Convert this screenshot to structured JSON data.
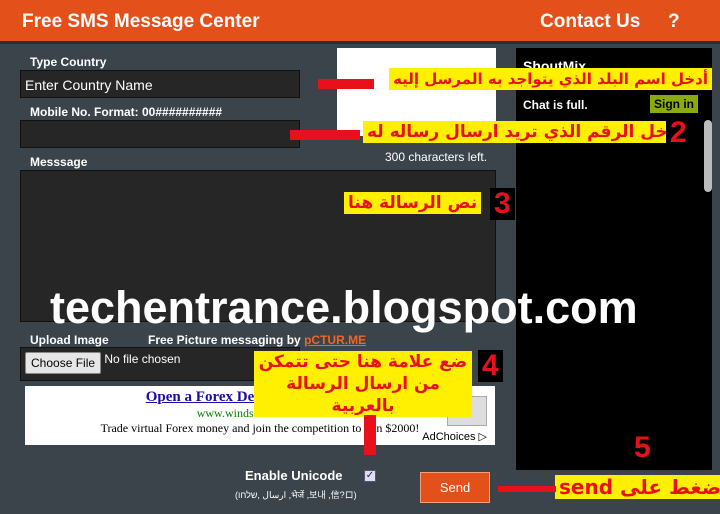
{
  "header": {
    "title": "Free SMS Message Center",
    "contact": "Contact Us",
    "help": "?"
  },
  "form": {
    "country_label": "Type Country",
    "country_value": "Enter Country Name",
    "mobile_label": "Mobile No. Format: 00##########",
    "mobile_value": "",
    "message_label": "Messsage",
    "chars_left": "300 characters left.",
    "upload_label": "Upload Image",
    "pictures_text": "Free Picture messaging by",
    "pictures_link": "pCTUR.ME",
    "choose_file": "Choose File",
    "no_file": "No file chosen",
    "unicode_label": "Enable Unicode",
    "unicode_checked": true,
    "unicode_examples": "(ارسال ,שלחו ,भेजें ,보내 ,信?ロ)",
    "send": "Send"
  },
  "ad": {
    "title": "Open a Forex De",
    "url": "www.windsorbrokers.com",
    "text": "Trade virtual Forex money and join the competition to win $2000!",
    "adchoices": "AdChoices"
  },
  "shoutmix": {
    "title": "ShoutMix",
    "status": "Chat is full.",
    "sign_in": "Sign in"
  },
  "watermark": "techentrance.blogspot.com",
  "annotations": [
    {
      "num": "",
      "text": "أدخل اسم البلد الذي يتواجد به المرسل إليه"
    },
    {
      "num": "2",
      "text": "أدخل الرقم الذي تريد ارسال رساله له"
    },
    {
      "num": "3",
      "text": "نص الرسالة هنا"
    },
    {
      "num": "4",
      "text": "ضع علامة هنا حتى تتمكن من ارسال الرسالة بالعربية"
    },
    {
      "num": "5",
      "text": "اضغط على send"
    }
  ]
}
